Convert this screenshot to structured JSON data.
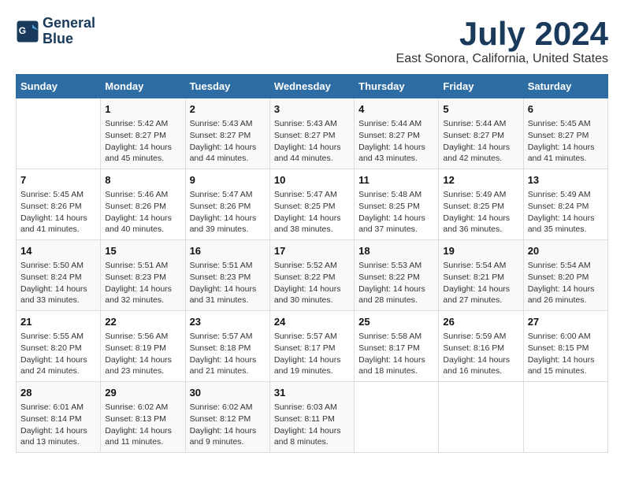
{
  "logo": {
    "line1": "General",
    "line2": "Blue"
  },
  "title": "July 2024",
  "subtitle": "East Sonora, California, United States",
  "days_of_week": [
    "Sunday",
    "Monday",
    "Tuesday",
    "Wednesday",
    "Thursday",
    "Friday",
    "Saturday"
  ],
  "weeks": [
    [
      {
        "day": "",
        "info": ""
      },
      {
        "day": "1",
        "info": "Sunrise: 5:42 AM\nSunset: 8:27 PM\nDaylight: 14 hours\nand 45 minutes."
      },
      {
        "day": "2",
        "info": "Sunrise: 5:43 AM\nSunset: 8:27 PM\nDaylight: 14 hours\nand 44 minutes."
      },
      {
        "day": "3",
        "info": "Sunrise: 5:43 AM\nSunset: 8:27 PM\nDaylight: 14 hours\nand 44 minutes."
      },
      {
        "day": "4",
        "info": "Sunrise: 5:44 AM\nSunset: 8:27 PM\nDaylight: 14 hours\nand 43 minutes."
      },
      {
        "day": "5",
        "info": "Sunrise: 5:44 AM\nSunset: 8:27 PM\nDaylight: 14 hours\nand 42 minutes."
      },
      {
        "day": "6",
        "info": "Sunrise: 5:45 AM\nSunset: 8:27 PM\nDaylight: 14 hours\nand 41 minutes."
      }
    ],
    [
      {
        "day": "7",
        "info": "Sunrise: 5:45 AM\nSunset: 8:26 PM\nDaylight: 14 hours\nand 41 minutes."
      },
      {
        "day": "8",
        "info": "Sunrise: 5:46 AM\nSunset: 8:26 PM\nDaylight: 14 hours\nand 40 minutes."
      },
      {
        "day": "9",
        "info": "Sunrise: 5:47 AM\nSunset: 8:26 PM\nDaylight: 14 hours\nand 39 minutes."
      },
      {
        "day": "10",
        "info": "Sunrise: 5:47 AM\nSunset: 8:25 PM\nDaylight: 14 hours\nand 38 minutes."
      },
      {
        "day": "11",
        "info": "Sunrise: 5:48 AM\nSunset: 8:25 PM\nDaylight: 14 hours\nand 37 minutes."
      },
      {
        "day": "12",
        "info": "Sunrise: 5:49 AM\nSunset: 8:25 PM\nDaylight: 14 hours\nand 36 minutes."
      },
      {
        "day": "13",
        "info": "Sunrise: 5:49 AM\nSunset: 8:24 PM\nDaylight: 14 hours\nand 35 minutes."
      }
    ],
    [
      {
        "day": "14",
        "info": "Sunrise: 5:50 AM\nSunset: 8:24 PM\nDaylight: 14 hours\nand 33 minutes."
      },
      {
        "day": "15",
        "info": "Sunrise: 5:51 AM\nSunset: 8:23 PM\nDaylight: 14 hours\nand 32 minutes."
      },
      {
        "day": "16",
        "info": "Sunrise: 5:51 AM\nSunset: 8:23 PM\nDaylight: 14 hours\nand 31 minutes."
      },
      {
        "day": "17",
        "info": "Sunrise: 5:52 AM\nSunset: 8:22 PM\nDaylight: 14 hours\nand 30 minutes."
      },
      {
        "day": "18",
        "info": "Sunrise: 5:53 AM\nSunset: 8:22 PM\nDaylight: 14 hours\nand 28 minutes."
      },
      {
        "day": "19",
        "info": "Sunrise: 5:54 AM\nSunset: 8:21 PM\nDaylight: 14 hours\nand 27 minutes."
      },
      {
        "day": "20",
        "info": "Sunrise: 5:54 AM\nSunset: 8:20 PM\nDaylight: 14 hours\nand 26 minutes."
      }
    ],
    [
      {
        "day": "21",
        "info": "Sunrise: 5:55 AM\nSunset: 8:20 PM\nDaylight: 14 hours\nand 24 minutes."
      },
      {
        "day": "22",
        "info": "Sunrise: 5:56 AM\nSunset: 8:19 PM\nDaylight: 14 hours\nand 23 minutes."
      },
      {
        "day": "23",
        "info": "Sunrise: 5:57 AM\nSunset: 8:18 PM\nDaylight: 14 hours\nand 21 minutes."
      },
      {
        "day": "24",
        "info": "Sunrise: 5:57 AM\nSunset: 8:17 PM\nDaylight: 14 hours\nand 19 minutes."
      },
      {
        "day": "25",
        "info": "Sunrise: 5:58 AM\nSunset: 8:17 PM\nDaylight: 14 hours\nand 18 minutes."
      },
      {
        "day": "26",
        "info": "Sunrise: 5:59 AM\nSunset: 8:16 PM\nDaylight: 14 hours\nand 16 minutes."
      },
      {
        "day": "27",
        "info": "Sunrise: 6:00 AM\nSunset: 8:15 PM\nDaylight: 14 hours\nand 15 minutes."
      }
    ],
    [
      {
        "day": "28",
        "info": "Sunrise: 6:01 AM\nSunset: 8:14 PM\nDaylight: 14 hours\nand 13 minutes."
      },
      {
        "day": "29",
        "info": "Sunrise: 6:02 AM\nSunset: 8:13 PM\nDaylight: 14 hours\nand 11 minutes."
      },
      {
        "day": "30",
        "info": "Sunrise: 6:02 AM\nSunset: 8:12 PM\nDaylight: 14 hours\nand 9 minutes."
      },
      {
        "day": "31",
        "info": "Sunrise: 6:03 AM\nSunset: 8:11 PM\nDaylight: 14 hours\nand 8 minutes."
      },
      {
        "day": "",
        "info": ""
      },
      {
        "day": "",
        "info": ""
      },
      {
        "day": "",
        "info": ""
      }
    ]
  ]
}
